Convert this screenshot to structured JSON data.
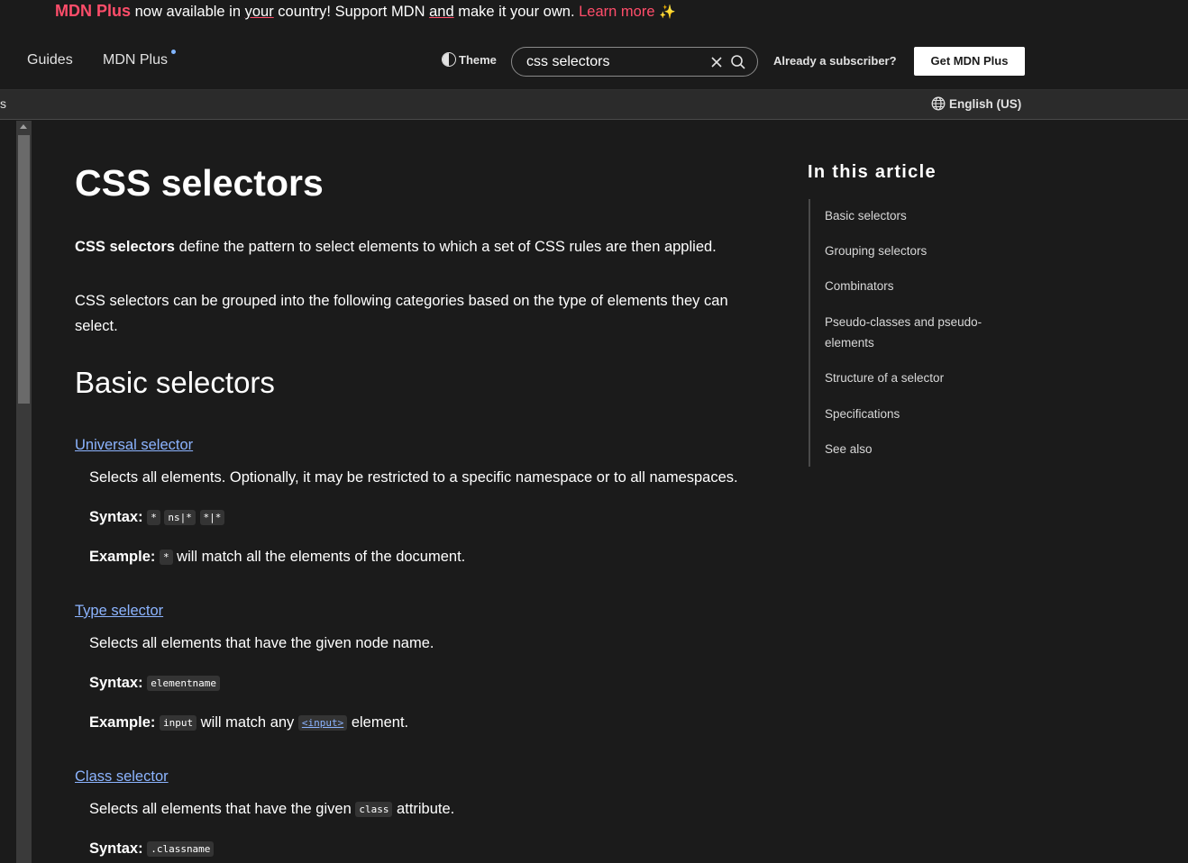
{
  "banner": {
    "brand": "MDN Plus",
    "text_1": " now available in ",
    "text_2": "your",
    "text_3": " country! Support MDN ",
    "text_4": "and",
    "text_5": " make it your own. ",
    "learn_more": "Learn more",
    "sparkle": "✨"
  },
  "nav": {
    "guides": "Guides",
    "mdn_plus": "MDN Plus",
    "theme": "Theme",
    "search_value": "css selectors",
    "subscriber": "Already a subscriber?",
    "get_plus": "Get MDN Plus"
  },
  "langbar": {
    "edge_text": "s",
    "language": "English (US)"
  },
  "article": {
    "title": "CSS selectors",
    "intro_bold": "CSS selectors",
    "intro_rest": " define the pattern to select elements to which a set of CSS rules are then applied.",
    "categories": "CSS selectors can be grouped into the following categories based on the type of elements they can select.",
    "section_heading": "Basic selectors",
    "syntax_label": "Syntax:",
    "example_label": "Example:",
    "universal": {
      "link": "Universal selector",
      "desc": "Selects all elements. Optionally, it may be restricted to a specific namespace or to all namespaces.",
      "syntax": [
        "*",
        "ns|*",
        "*|*"
      ],
      "example_code": "*",
      "example_text": " will match all the elements of the document."
    },
    "type": {
      "link": "Type selector",
      "desc": "Selects all elements that have the given node name.",
      "syntax": "elementname",
      "example_code": "input",
      "example_text_1": " will match any ",
      "example_link": "<input>",
      "example_text_2": " element."
    },
    "class": {
      "link": "Class selector",
      "desc_1": "Selects all elements that have the given ",
      "desc_code": "class",
      "desc_2": " attribute.",
      "syntax": ".classname"
    }
  },
  "toc": {
    "title": "In this article",
    "items": [
      "Basic selectors",
      "Grouping selectors",
      "Combinators",
      "Pseudo-classes and pseudo-elements",
      "Structure of a selector",
      "Specifications",
      "See also"
    ]
  },
  "colors": {
    "background": "#1b1b1b",
    "accent_pink": "#ff4d6a",
    "link_blue": "#8cb4ff"
  }
}
